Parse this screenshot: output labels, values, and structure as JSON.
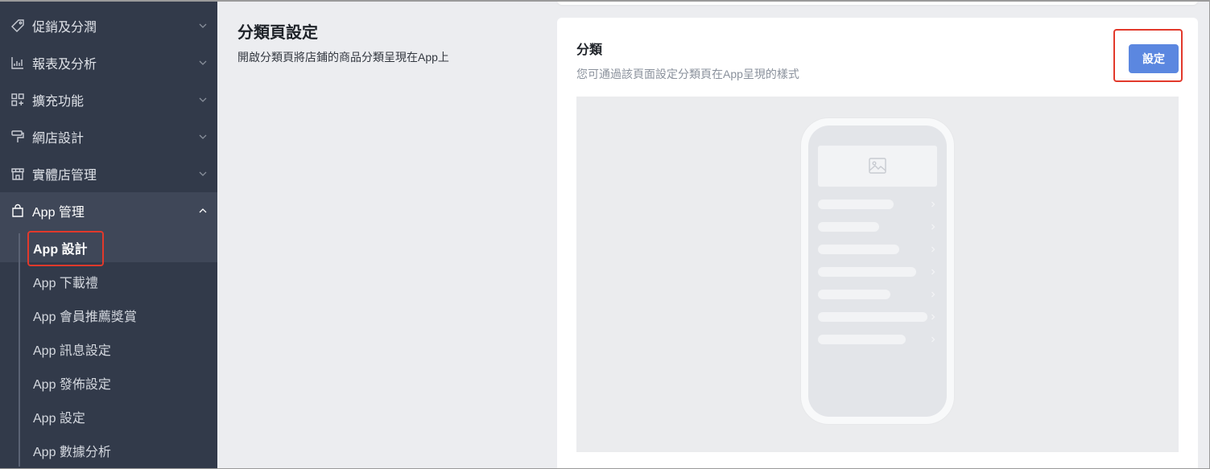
{
  "sidebar": {
    "menu": [
      {
        "label": "促銷及分潤",
        "icon": "tag-icon"
      },
      {
        "label": "報表及分析",
        "icon": "chart-icon"
      },
      {
        "label": "擴充功能",
        "icon": "apps-icon"
      },
      {
        "label": "網店設計",
        "icon": "paint-roller-icon"
      },
      {
        "label": "實體店管理",
        "icon": "store-icon"
      },
      {
        "label": "App 管理",
        "icon": "shopping-bag-icon"
      }
    ],
    "submenu": [
      {
        "label": "App 設計"
      },
      {
        "label": "App 下載禮"
      },
      {
        "label": "App 會員推薦獎賞"
      },
      {
        "label": "App 訊息設定"
      },
      {
        "label": "App 發佈設定"
      },
      {
        "label": "App 設定"
      },
      {
        "label": "App 數據分析"
      }
    ]
  },
  "section": {
    "title": "分類頁設定",
    "description": "開啟分類頁將店鋪的商品分類呈現在App上"
  },
  "card": {
    "title": "分類",
    "description": "您可通過該頁面設定分類頁在App呈現的樣式",
    "button_label": "設定"
  },
  "colors": {
    "sidebar_bg": "#323a4a",
    "accent": "#5b87e0",
    "highlight": "#e2392b"
  }
}
